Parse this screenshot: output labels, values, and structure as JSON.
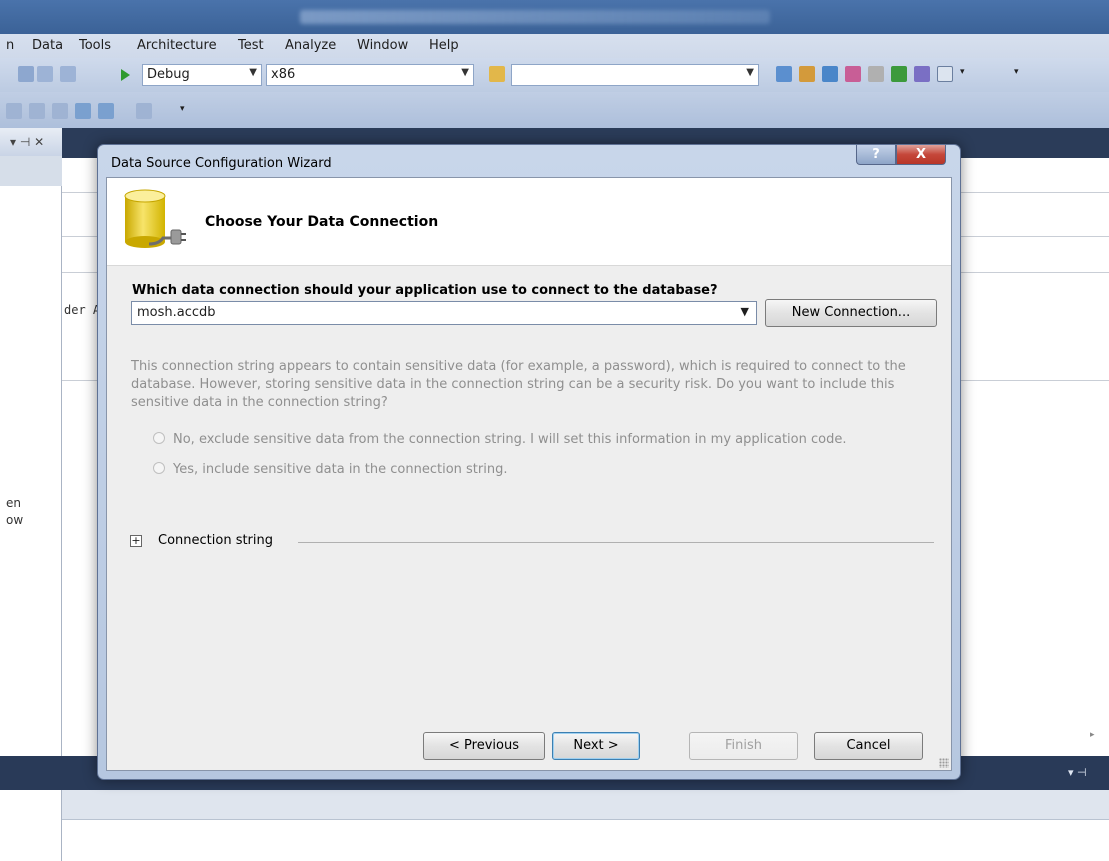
{
  "menu": {
    "partial_first": "n",
    "items": [
      "Data",
      "Tools",
      "Architecture",
      "Test",
      "Analyze",
      "Window",
      "Help"
    ]
  },
  "toolbar": {
    "config_value": "Debug",
    "platform_value": "x86",
    "search_value": ""
  },
  "background_text": {
    "editor_fragment": "der A",
    "side_line1": "en",
    "side_line2": "ow"
  },
  "dialog": {
    "title": "Data Source Configuration Wizard",
    "help_glyph": "?",
    "close_glyph": "X",
    "heading": "Choose Your Data Connection",
    "question": "Which data connection should your application use to connect to the database?",
    "connection_value": "mosh.accdb",
    "new_connection_label": "New Connection...",
    "sensitive_text": "This connection string appears to contain sensitive data (for example, a password), which is required to connect to the database. However, storing sensitive data in the connection string can be a security risk. Do you want to include this sensitive data in the connection string?",
    "radio_exclude": "No, exclude sensitive data from the connection string. I will set this information in my application code.",
    "radio_include": "Yes, include sensitive data in the connection string.",
    "connection_string_label": "Connection string",
    "expand_glyph": "+",
    "buttons": {
      "previous": "< Previous",
      "next": "Next >",
      "finish": "Finish",
      "cancel": "Cancel"
    }
  },
  "colors": {
    "ide_dark": "#2b3c59",
    "dialog_frame": "#b6c7e0",
    "disabled_text": "#8f8f8f"
  }
}
